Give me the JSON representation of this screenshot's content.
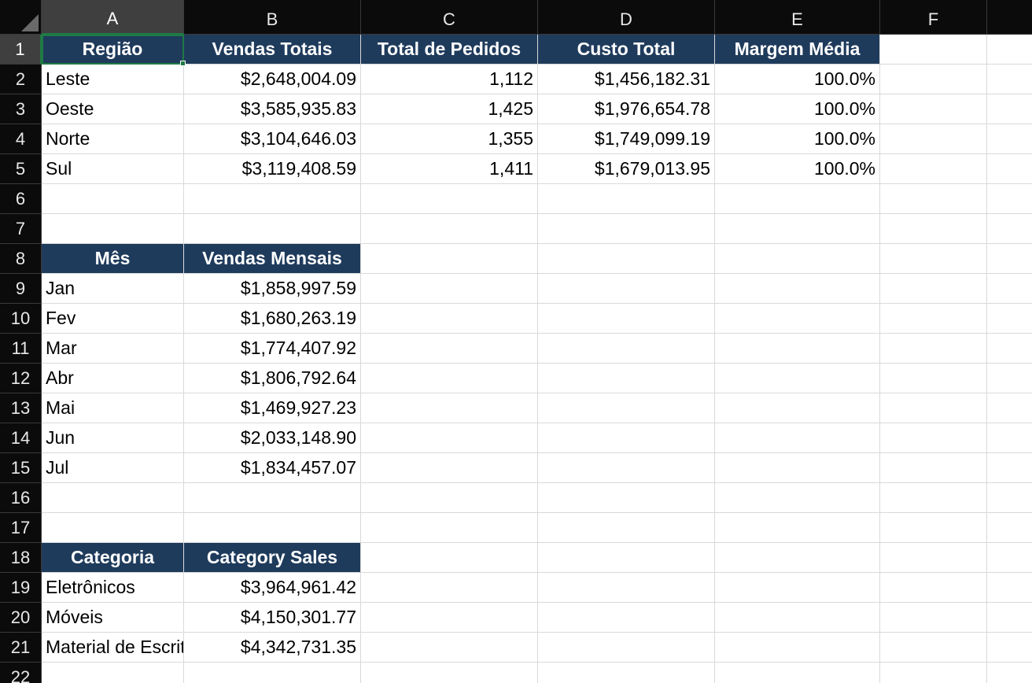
{
  "columns": [
    "A",
    "B",
    "C",
    "D",
    "E",
    "F"
  ],
  "rows": [
    "1",
    "2",
    "3",
    "4",
    "5",
    "6",
    "7",
    "8",
    "9",
    "10",
    "11",
    "12",
    "13",
    "14",
    "15",
    "16",
    "17",
    "18",
    "19",
    "20",
    "21",
    "22"
  ],
  "active_cell": "A1",
  "colors": {
    "header_fill": "#1f3b5c",
    "header_text": "#ffffff",
    "selection": "#1f7a45",
    "chrome_bg": "#0b0b0b"
  },
  "cells": {
    "A1": "Região",
    "B1": "Vendas Totais",
    "C1": "Total de Pedidos",
    "D1": "Custo Total",
    "E1": "Margem Média",
    "A2": "Leste",
    "B2": "$2,648,004.09",
    "C2": "1,112",
    "D2": "$1,456,182.31",
    "E2": "100.0%",
    "A3": "Oeste",
    "B3": "$3,585,935.83",
    "C3": "1,425",
    "D3": "$1,976,654.78",
    "E3": "100.0%",
    "A4": "Norte",
    "B4": "$3,104,646.03",
    "C4": "1,355",
    "D4": "$1,749,099.19",
    "E4": "100.0%",
    "A5": "Sul",
    "B5": "$3,119,408.59",
    "C5": "1,411",
    "D5": "$1,679,013.95",
    "E5": "100.0%",
    "A8": "Mês",
    "B8": "Vendas Mensais",
    "A9": "Jan",
    "B9": "$1,858,997.59",
    "A10": "Fev",
    "B10": "$1,680,263.19",
    "A11": "Mar",
    "B11": "$1,774,407.92",
    "A12": "Abr",
    "B12": "$1,806,792.64",
    "A13": "Mai",
    "B13": "$1,469,927.23",
    "A14": "Jun",
    "B14": "$2,033,148.90",
    "A15": "Jul",
    "B15": "$1,834,457.07",
    "A18": "Categoria",
    "B18": "Category Sales",
    "A19": "Eletrônicos",
    "B19": "$3,964,961.42",
    "A20": "Móveis",
    "B20": "$4,150,301.77",
    "A21": "Material de Escritório",
    "B21": "$4,342,731.35"
  },
  "header_cells": [
    "A1",
    "B1",
    "C1",
    "D1",
    "E1",
    "A8",
    "B8",
    "A18",
    "B18"
  ],
  "numeric_cells": [
    "B2",
    "C2",
    "D2",
    "E2",
    "B3",
    "C3",
    "D3",
    "E3",
    "B4",
    "C4",
    "D4",
    "E4",
    "B5",
    "C5",
    "D5",
    "E5",
    "B9",
    "B10",
    "B11",
    "B12",
    "B13",
    "B14",
    "B15",
    "B19",
    "B20",
    "B21"
  ]
}
